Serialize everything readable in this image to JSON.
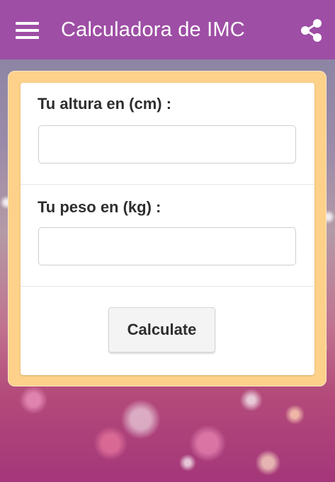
{
  "appbar": {
    "title": "Calculadora de IMC",
    "menu_icon": "hamburger-menu-icon",
    "share_icon": "share-icon",
    "background_color": "#9e4ea5"
  },
  "form": {
    "height_label": "Tu altura en (cm) :",
    "height_value": "",
    "weight_label": "Tu peso en (kg) :",
    "weight_value": "",
    "calculate_label": "Calculate"
  },
  "colors": {
    "card_border": "#fdd18a",
    "card_background": "#ffffff"
  }
}
